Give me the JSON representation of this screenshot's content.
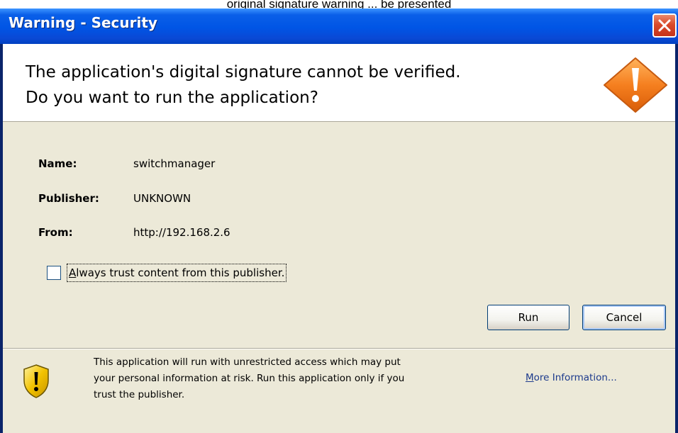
{
  "caption_fragment": "original signature warning ... be presented",
  "window": {
    "title": "Warning - Security"
  },
  "header": {
    "line1": "The application's digital signature cannot be verified.",
    "line2": "Do you want to run the application?"
  },
  "details": {
    "name_label": "Name:",
    "name_value": "switchmanager",
    "publisher_label": "Publisher:",
    "publisher_value": "UNKNOWN",
    "from_label": "From:",
    "from_value": "http://192.168.2.6"
  },
  "trust": {
    "mnemonic": "A",
    "label_rest": "lways trust content from this publisher.",
    "checked": false
  },
  "buttons": {
    "run": "Run",
    "cancel": "Cancel"
  },
  "footer": {
    "line1": "This application will run with unrestricted access which may put",
    "line2": "your personal information at risk. Run this application only if you",
    "line3": "trust the publisher.",
    "more_info_mnemonic": "M",
    "more_info_rest": "ore Information..."
  },
  "icons": {
    "close": "close-icon",
    "warning": "warning-diamond-icon",
    "shield": "shield-warning-icon"
  },
  "colors": {
    "titlebar": "#0055e5",
    "close_button": "#d94a2b",
    "warning_orange": "#f57f1f",
    "shield_yellow": "#f2c200",
    "dialog_bg": "#ece9d8"
  }
}
